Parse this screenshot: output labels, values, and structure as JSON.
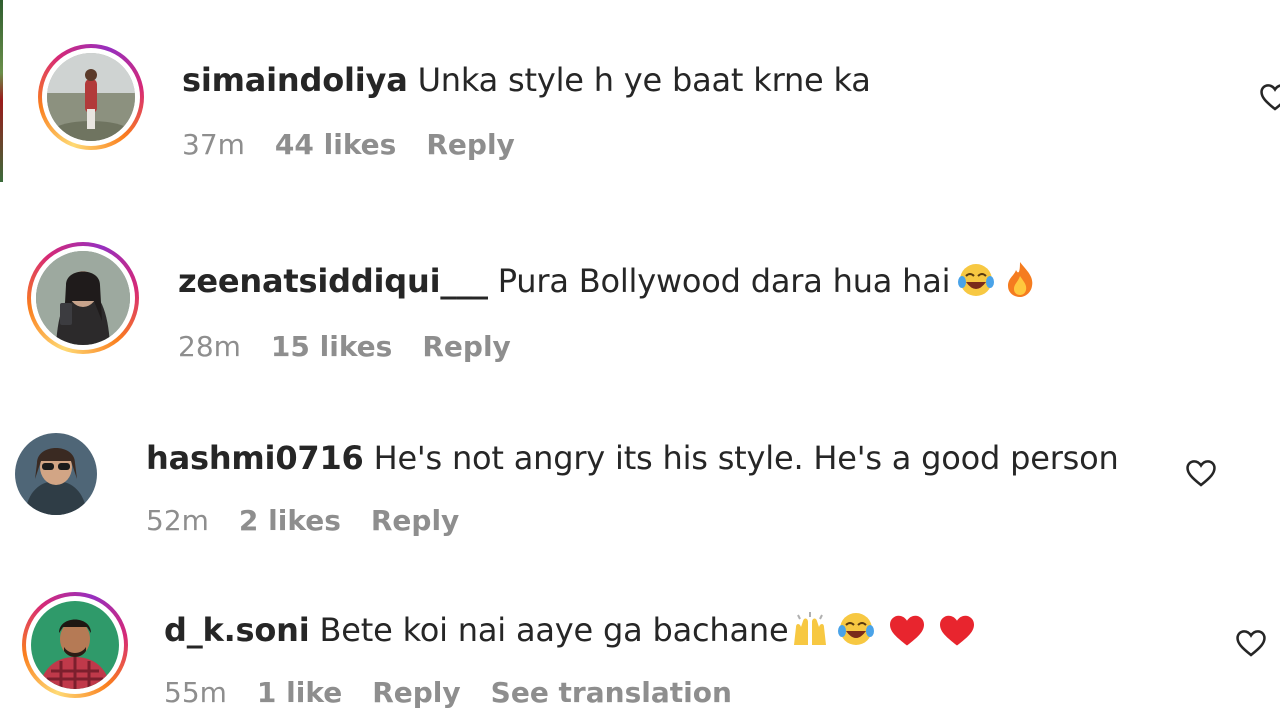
{
  "comments": [
    {
      "username": "simaindoliya",
      "text": "Unka style h ye baat krne ka",
      "time": "37m",
      "likes": "44 likes",
      "reply": "Reply"
    },
    {
      "username": "zeenatsiddiqui___",
      "text": "Pura Bollywood dara hua hai",
      "emojis": [
        "laughing-tears-emoji",
        "fire-emoji"
      ],
      "time": "28m",
      "likes": "15 likes",
      "reply": "Reply"
    },
    {
      "username": "hashmi0716",
      "text": "He's not angry its his style. He's a good person",
      "time": "52m",
      "likes": "2 likes",
      "reply": "Reply"
    },
    {
      "username": "d_k.soni",
      "text": "Bete koi nai aaye ga bachane",
      "emojis": [
        "raising-hands-emoji",
        "laughing-tears-emoji",
        "red-heart-emoji",
        "red-heart-emoji"
      ],
      "time": "55m",
      "likes": "1 like",
      "reply": "Reply",
      "translate": "See translation"
    }
  ],
  "icons": {
    "like": "heart-outline-icon"
  },
  "colors": {
    "text": "#262626",
    "muted": "#8e8e8e",
    "story_ring": [
      "#feda75",
      "#fa7e1e",
      "#d62976",
      "#962fbf"
    ]
  }
}
